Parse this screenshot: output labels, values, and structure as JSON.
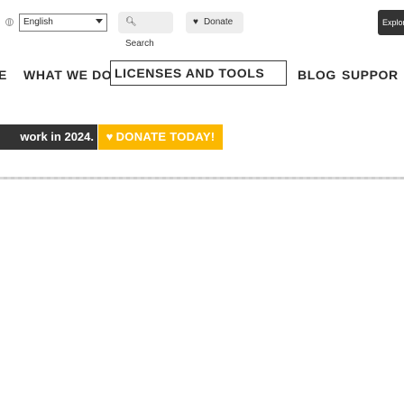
{
  "top_bar": {
    "language_select": {
      "value": "English"
    },
    "search_label": "Search",
    "donate_label": "Donate",
    "explore_label": "Explor"
  },
  "main_nav": {
    "items": [
      {
        "label": "E"
      },
      {
        "label": "WHAT WE DO"
      },
      {
        "label": "LICENSES AND TOOLS"
      },
      {
        "label": "BLOG"
      },
      {
        "label": "SUPPOR"
      }
    ]
  },
  "banner": {
    "text": "work in 2024.",
    "donate_button_label": "DONATE TODAY!"
  },
  "colors": {
    "accent": "#fbb800",
    "dark": "#333333"
  },
  "icons": [
    "globe-icon",
    "search-icon",
    "heart-icon"
  ]
}
